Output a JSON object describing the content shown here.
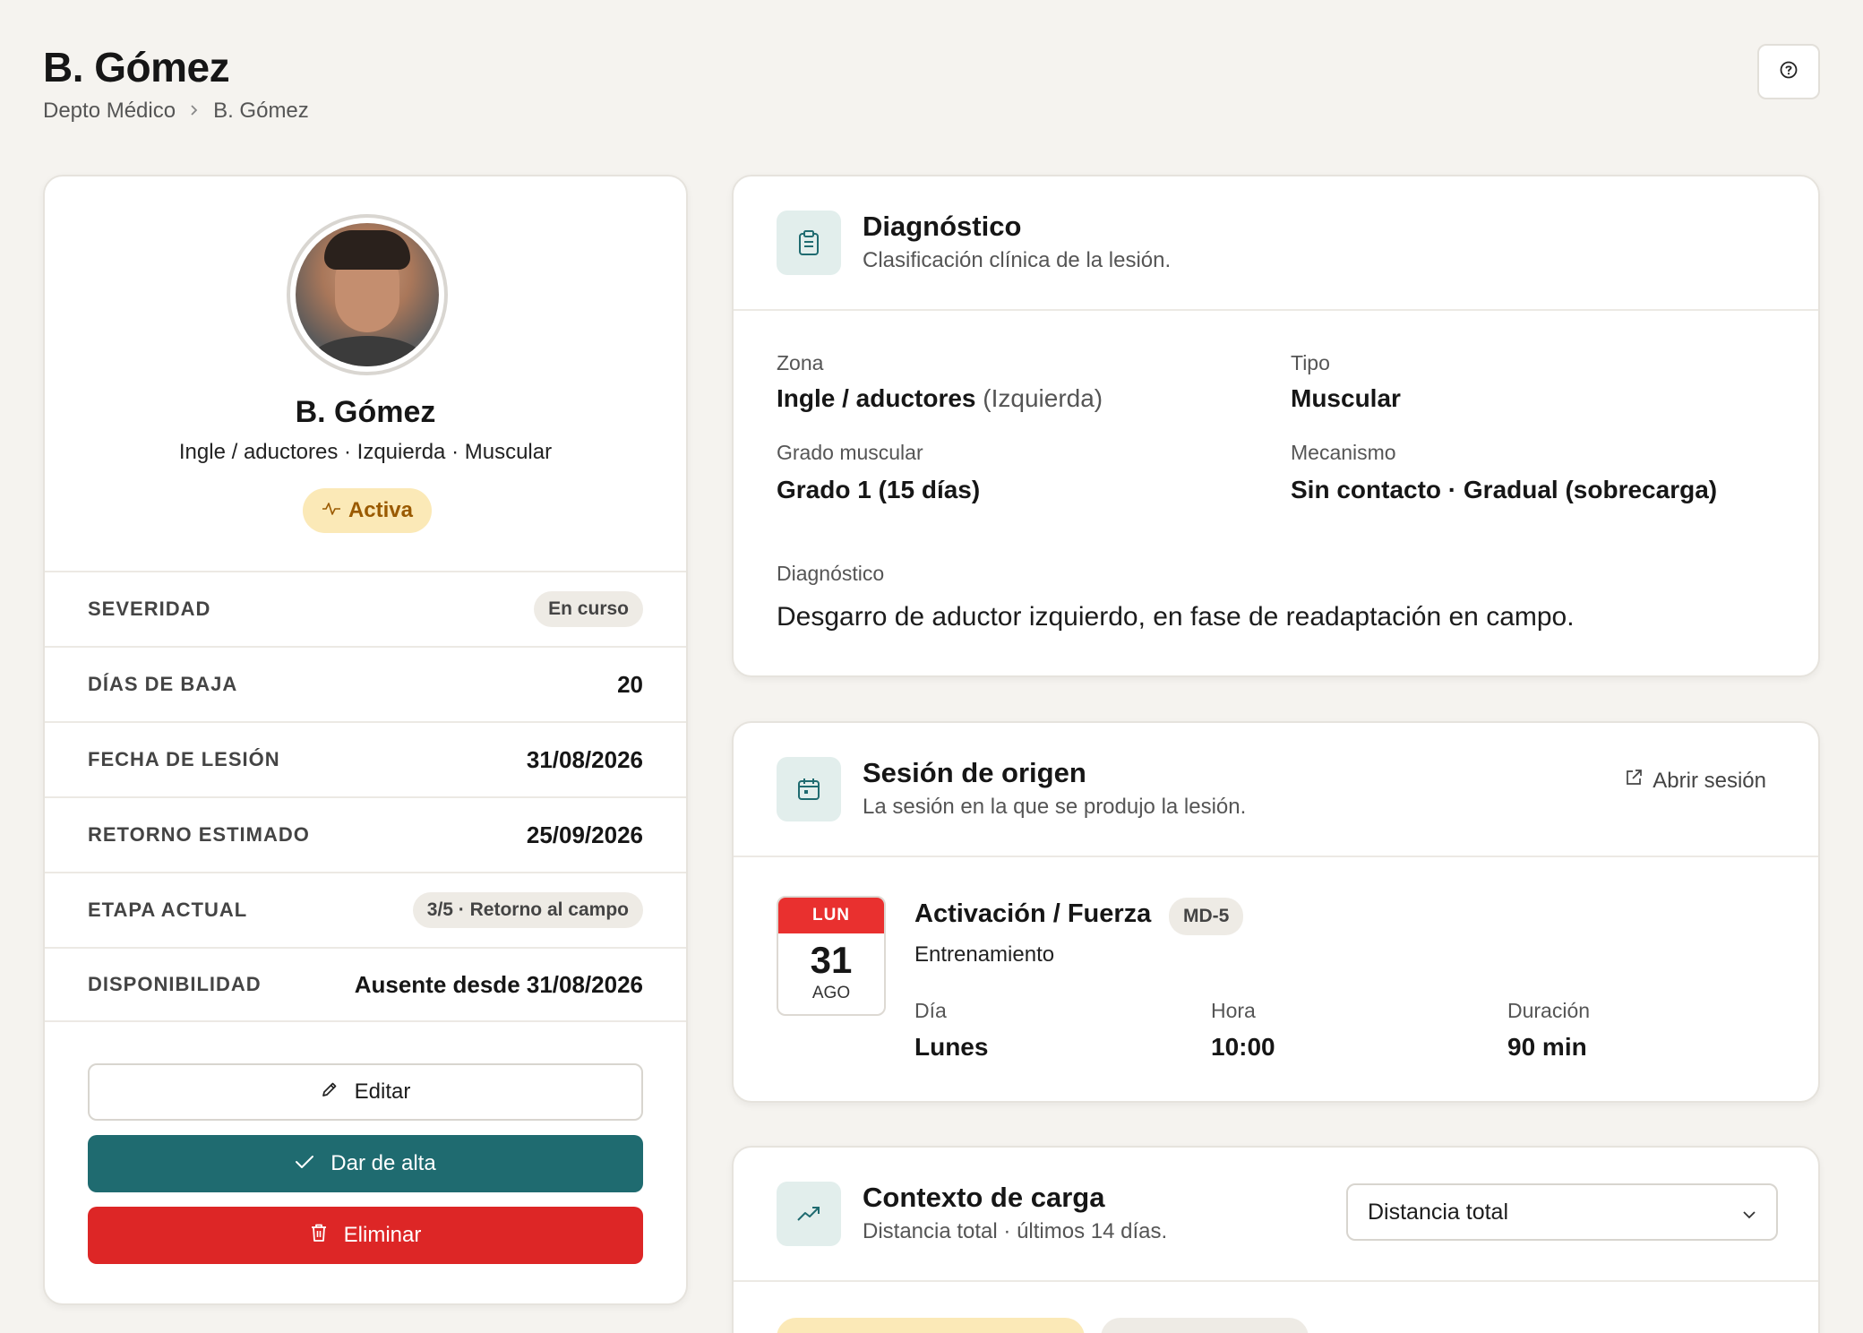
{
  "header": {
    "title": "B. Gómez",
    "breadcrumb": [
      "Depto Médico",
      "B. Gómez"
    ]
  },
  "profile": {
    "name": "B. Gómez",
    "subtitle": "Ingle / aductores · Izquierda · Muscular",
    "status": "Activa",
    "rows": [
      {
        "label": "SEVERIDAD",
        "value": "En curso",
        "style": "pill"
      },
      {
        "label": "DÍAS DE BAJA",
        "value": "20",
        "style": "bold"
      },
      {
        "label": "FECHA DE LESIÓN",
        "value": "31/08/2026",
        "style": "bold"
      },
      {
        "label": "RETORNO ESTIMADO",
        "value": "25/09/2026",
        "style": "bold"
      },
      {
        "label": "ETAPA ACTUAL",
        "value": "3/5 · Retorno al campo",
        "style": "pill"
      },
      {
        "label": "DISPONIBILIDAD",
        "value": "Ausente desde 31/08/2026",
        "style": "bold"
      }
    ],
    "actions": {
      "edit": "Editar",
      "discharge": "Dar de alta",
      "delete": "Eliminar"
    }
  },
  "diagnosis": {
    "title": "Diagnóstico",
    "subtitle": "Clasificación clínica de la lesión.",
    "zone_label": "Zona",
    "zone_value": "Ingle / aductores",
    "zone_side": "(Izquierda)",
    "type_label": "Tipo",
    "type_value": "Muscular",
    "grade_label": "Grado muscular",
    "grade_value": "Grado 1 (15 días)",
    "mechanism_label": "Mecanismo",
    "mechanism_value": "Sin contacto · Gradual (sobrecarga)",
    "diagnosis_label": "Diagnóstico",
    "diagnosis_text": "Desgarro de aductor izquierdo, en fase de readaptación en campo."
  },
  "session": {
    "title": "Sesión de origen",
    "subtitle": "La sesión en la que se produjo la lesión.",
    "open_link": "Abrir sesión",
    "calendar": {
      "weekday": "LUN",
      "day": "31",
      "month": "AGO"
    },
    "name": "Activación / Fuerza",
    "tag": "MD-5",
    "type": "Entrenamiento",
    "day_label": "Día",
    "day_value": "Lunes",
    "time_label": "Hora",
    "time_value": "10:00",
    "duration_label": "Duración",
    "duration_value": "90 min"
  },
  "load": {
    "title": "Contexto de carga",
    "subtitle": "Distancia total · últimos 14 días.",
    "select_value": "Distancia total"
  },
  "colors": {
    "background": "#f5f3ef",
    "accent_teal": "#1f6b70",
    "danger": "#dd2626",
    "active_badge_bg": "#fbe9b7",
    "active_badge_fg": "#9a5a00",
    "calendar_red": "#e9302f"
  }
}
